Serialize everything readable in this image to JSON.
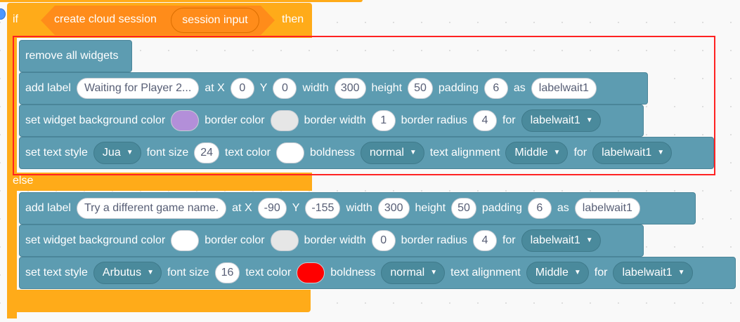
{
  "if_block": {
    "if_label": "if",
    "condition_label": "create cloud session",
    "condition_input": "session input",
    "then_label": "then",
    "else_label": "else"
  },
  "then_branch": {
    "remove_all": "remove all widgets",
    "add_label": {
      "label": "add label",
      "text": "Waiting for Player 2...",
      "at_x_label": "at X",
      "x": "0",
      "y_label": "Y",
      "y": "0",
      "width_label": "width",
      "width": "300",
      "height_label": "height",
      "height": "50",
      "padding_label": "padding",
      "padding": "6",
      "as_label": "as",
      "name": "labelwait1"
    },
    "set_bg": {
      "label": "set widget background color",
      "bg_color": "#b38fd9",
      "border_color_label": "border color",
      "border_color": "#e6e6e6",
      "border_width_label": "border width",
      "border_width": "1",
      "border_radius_label": "border radius",
      "border_radius": "4",
      "for_label": "for",
      "target": "labelwait1"
    },
    "set_text": {
      "label": "set text style",
      "font": "Jua",
      "font_size_label": "font size",
      "font_size": "24",
      "text_color_label": "text color",
      "text_color": "#ffffff",
      "boldness_label": "boldness",
      "boldness": "normal",
      "align_label": "text alignment",
      "align": "Middle",
      "for_label": "for",
      "target": "labelwait1"
    }
  },
  "else_branch": {
    "add_label": {
      "label": "add label",
      "text": "Try a different game name.",
      "at_x_label": "at X",
      "x": "-90",
      "y_label": "Y",
      "y": "-155",
      "width_label": "width",
      "width": "300",
      "height_label": "height",
      "height": "50",
      "padding_label": "padding",
      "padding": "6",
      "as_label": "as",
      "name": "labelwait1"
    },
    "set_bg": {
      "label": "set widget background color",
      "bg_color": "#ffffff",
      "border_color_label": "border color",
      "border_color": "#e6e6e6",
      "border_width_label": "border width",
      "border_width": "0",
      "border_radius_label": "border radius",
      "border_radius": "4",
      "for_label": "for",
      "target": "labelwait1"
    },
    "set_text": {
      "label": "set text style",
      "font": "Arbutus",
      "font_size_label": "font size",
      "font_size": "16",
      "text_color_label": "text color",
      "text_color": "#ff0000",
      "boldness_label": "boldness",
      "boldness": "normal",
      "align_label": "text alignment",
      "align": "Middle",
      "for_label": "for",
      "target": "labelwait1"
    }
  },
  "colors": {
    "control_orange": "#ffab19",
    "block_teal": "#5d9cb1",
    "selection_red": "#ff2222"
  }
}
